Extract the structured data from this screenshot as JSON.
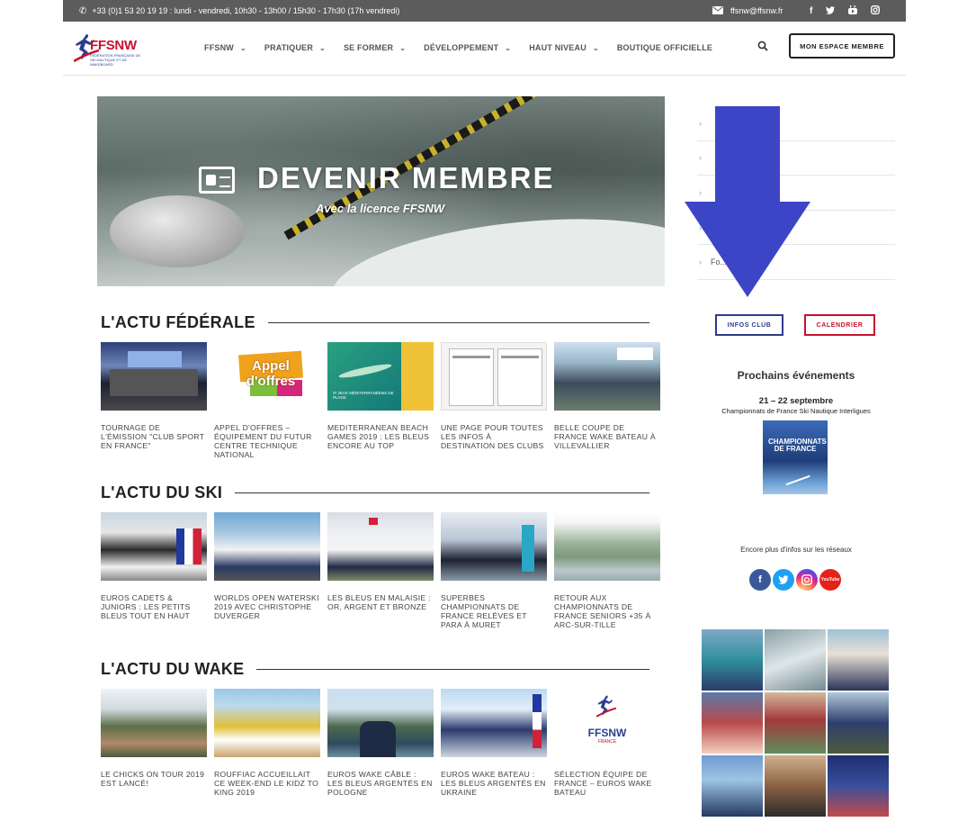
{
  "topbar": {
    "phone": "+33 (0)1 53 20 19 19 : lundi - vendredi, 10h30 - 13h00 / 15h30 - 17h30 (17h vendredi)",
    "email": "ffsnw@ffsnw.fr",
    "social_icons": [
      "facebook-icon",
      "twitter-icon",
      "youtube-icon",
      "instagram-icon"
    ]
  },
  "header": {
    "logo_text": "FFSNW",
    "logo_subtitle": "FÉDÉRATION FRANÇAISE DE SKI NAUTIQUE ET DE WAKEBOARD",
    "nav": [
      {
        "label": "FFSNW",
        "has_dropdown": true
      },
      {
        "label": "PRATIQUER",
        "has_dropdown": true
      },
      {
        "label": "SE FORMER",
        "has_dropdown": true
      },
      {
        "label": "DÉVELOPPEMENT",
        "has_dropdown": true
      },
      {
        "label": "HAUT NIVEAU",
        "has_dropdown": true
      },
      {
        "label": "BOUTIQUE OFFICIELLE",
        "has_dropdown": false
      }
    ],
    "member_button": "MON ESPACE MEMBRE"
  },
  "hero": {
    "title": "DEVENIR MEMBRE",
    "subtitle": "Avec la licence FFSNW"
  },
  "sections": {
    "federale": {
      "title": "L'ACTU FÉDÉRALE",
      "items": [
        {
          "caption": "TOURNAGE DE L'ÉMISSION \"CLUB SPORT EN FRANCE\""
        },
        {
          "caption": "APPEL D'OFFRES – ÉQUIPEMENT DU FUTUR CENTRE TECHNIQUE NATIONAL",
          "image_text": "Appel d'offres"
        },
        {
          "caption": "MEDITERRANEAN BEACH GAMES 2019 : LES BLEUS ENCORE AU TOP",
          "image_text": "2ᵉ JEUX MÉDITERRANÉENS DE PLAGE"
        },
        {
          "caption": "UNE PAGE POUR TOUTES LES INFOS À DESTINATION DES CLUBS"
        },
        {
          "caption": "BELLE COUPE DE FRANCE WAKE BATEAU À VILLEVALLIER"
        }
      ]
    },
    "ski": {
      "title": "L'ACTU DU SKI",
      "items": [
        {
          "caption": "EUROS CADETS & JUNIORS : LES PETITS BLEUS TOUT EN HAUT"
        },
        {
          "caption": "WORLDS OPEN WATERSKI 2019 AVEC CHRISTOPHE DUVERGER"
        },
        {
          "caption": "LES BLEUS EN MALAISIE : OR, ARGENT ET BRONZE"
        },
        {
          "caption": "SUPERBES CHAMPIONNATS DE FRANCE RELÈVES ET PARA À MURET"
        },
        {
          "caption": "RETOUR AUX CHAMPIONNATS DE FRANCE SENIORS +35 À ARC-SUR-TILLE"
        }
      ]
    },
    "wake": {
      "title": "L'ACTU DU WAKE",
      "items": [
        {
          "caption": "LE CHICKS ON TOUR 2019 EST LANCÉ!"
        },
        {
          "caption": "ROUFFIAC ACCUEILLAIT CE WEEK-END LE KIDZ TO KING 2019"
        },
        {
          "caption": "EUROS WAKE CÂBLE : LES BLEUS ARGENTÉS EN POLOGNE"
        },
        {
          "caption": "EUROS WAKE BATEAU : LES BLEUS ARGENTÉS EN UKRAINE"
        },
        {
          "caption": "SÉLECTION ÉQUIPE DE FRANCE – EUROS WAKE BATEAU",
          "image_text": "FFSNW",
          "image_subtext": "FRANCE"
        }
      ]
    }
  },
  "sidebar": {
    "links": [
      {
        "label": ""
      },
      {
        "label": ""
      },
      {
        "label": ""
      },
      {
        "label": ""
      },
      {
        "label": "Fo... ...tions"
      }
    ],
    "infos_club": "INFOS CLUB",
    "calendrier": "CALENDRIER",
    "events_title": "Prochains événements",
    "event_date": "21 – 22 septembre",
    "event_name": "Championnats de France Ski Nautique Interligues",
    "poster_title": "CHAMPIONNATS DE FRANCE",
    "reseaux_text": "Encore plus d'infos sur les réseaux",
    "social_icons": [
      "facebook-icon",
      "twitter-icon",
      "instagram-icon",
      "youtube-icon"
    ],
    "youtube_label": "YouTube"
  },
  "overlay": {
    "arrow_color": "#3d45c7"
  },
  "colors": {
    "topbar": "#5c5c5c",
    "brand_red": "#c8102e",
    "brand_blue": "#2e3a8c"
  }
}
